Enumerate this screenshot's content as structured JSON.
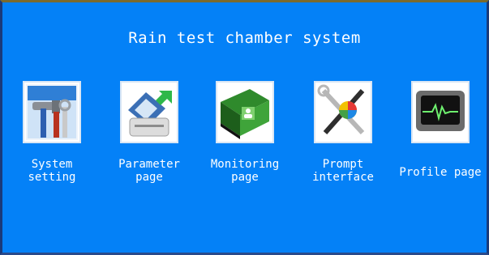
{
  "app": {
    "title": "Rain test chamber system"
  },
  "menu": [
    {
      "label": "System\nsetting",
      "icon": "tools-icon"
    },
    {
      "label": "Parameter\npage",
      "icon": "save-icon"
    },
    {
      "label": "Monitoring\npage",
      "icon": "contact-book-icon"
    },
    {
      "label": "Prompt\ninterface",
      "icon": "color-tools-icon"
    },
    {
      "label": "Profile page",
      "icon": "waveform-monitor-icon"
    }
  ],
  "colors": {
    "background": "#0481f7",
    "text": "#ffffff"
  }
}
